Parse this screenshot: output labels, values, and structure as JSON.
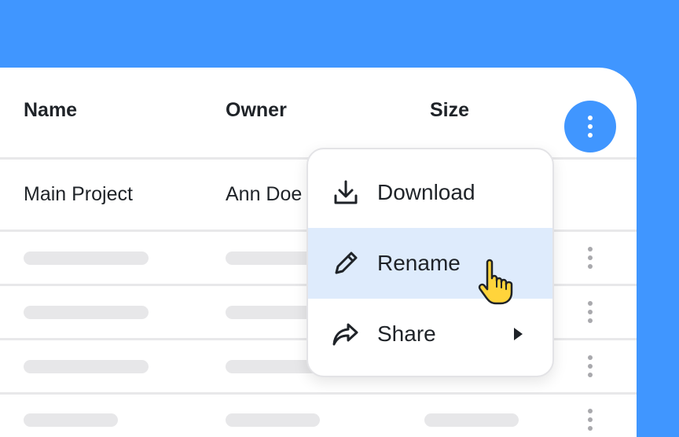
{
  "table": {
    "headers": {
      "name": "Name",
      "owner": "Owner",
      "size": "Size"
    },
    "first_row": {
      "name": "Main Project",
      "owner": "Ann Doe"
    }
  },
  "menu": {
    "items": [
      {
        "label": "Download",
        "icon": "download-icon"
      },
      {
        "label": "Rename",
        "icon": "pencil-icon",
        "highlighted": true
      },
      {
        "label": "Share",
        "icon": "share-arrow-icon",
        "submenu": true
      }
    ]
  },
  "colors": {
    "accent": "#4096ff",
    "highlight": "#deebfc",
    "cursor": "#ffd43b"
  }
}
